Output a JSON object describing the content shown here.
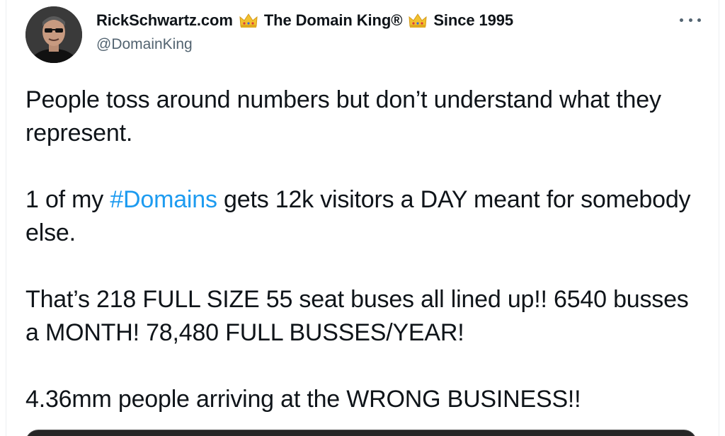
{
  "author": {
    "name_part1": "RickSchwartz.com",
    "name_part2": "The Domain King®",
    "name_part3": "Since 1995",
    "handle": "@DomainKing",
    "crown_icon": "crown-emoji",
    "avatar_icon": "profile-photo"
  },
  "tweet": {
    "p1": "People toss around numbers but don’t understand what they represent.",
    "p2_before": "1 of my ",
    "p2_hashtag": "#Domains",
    "p2_after": " gets 12k visitors a DAY meant for somebody else.",
    "p3": "That’s 218 FULL SIZE 55 seat buses all lined up!! 6540 busses a MONTH! 78,480 FULL BUSSES/YEAR!",
    "p4": "4.36mm people arriving at the WRONG BUSINESS!!"
  },
  "colors": {
    "text": "#0f1419",
    "secondary": "#536471",
    "link": "#1d9bf0"
  }
}
